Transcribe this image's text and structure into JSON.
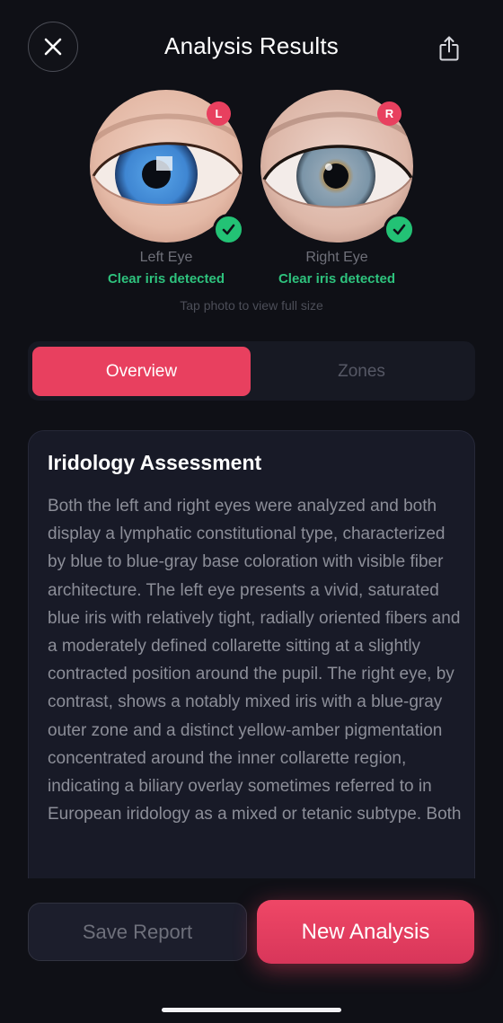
{
  "header": {
    "title": "Analysis Results",
    "close_icon": "close-icon",
    "share_icon": "share-icon"
  },
  "eyes": [
    {
      "badge": "L",
      "label": "Left Eye",
      "status": "Clear iris detected",
      "iris_color": "#3f86d2"
    },
    {
      "badge": "R",
      "label": "Right Eye",
      "status": "Clear iris detected",
      "iris_color": "#7b95a8"
    }
  ],
  "tap_hint": "Tap photo to view full size",
  "tabs": [
    {
      "label": "Overview",
      "active": true
    },
    {
      "label": "Zones",
      "active": false
    }
  ],
  "assessment": {
    "title": "Iridology Assessment",
    "body": "Both the left and right eyes were analyzed and both display a lymphatic constitutional type, characterized by blue to blue-gray base coloration with visible fiber architecture. The left eye presents a vivid, saturated blue iris with relatively tight, radially oriented fibers and a moderately defined collarette sitting at a slightly contracted position around the pupil. The right eye, by contrast, shows a notably mixed iris with a blue-gray outer zone and a distinct yellow-amber pigmentation concentrated around the inner collarette region, indicating a biliary overlay sometimes referred to in European iridology as a mixed or tetanic subtype. Both"
  },
  "actions": {
    "save_label": "Save Report",
    "new_label": "New Analysis"
  },
  "colors": {
    "accent": "#e8405f",
    "success": "#2ec27d",
    "background": "#0f1016",
    "card": "#181a27"
  }
}
